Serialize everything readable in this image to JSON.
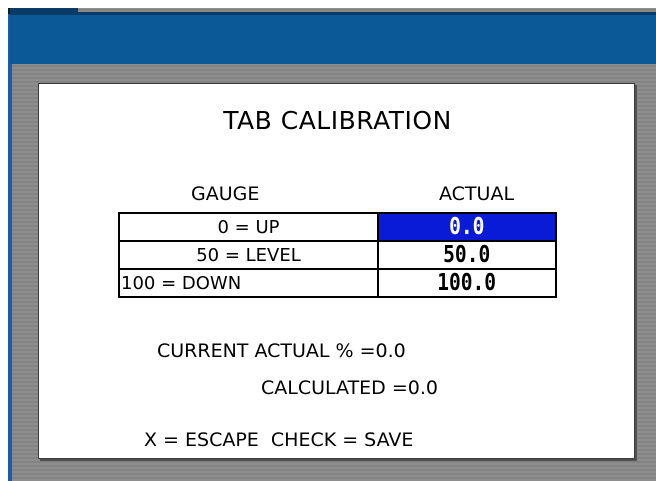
{
  "header": {
    "bar_color": "#0b5a97"
  },
  "panel": {
    "title": "TAB CALIBRATION",
    "columns": {
      "gauge": "GAUGE",
      "actual": "ACTUAL"
    },
    "rows": [
      {
        "gauge": "0 = UP",
        "actual": "0.0",
        "selected": true
      },
      {
        "gauge": "50 = LEVEL",
        "actual": "50.0",
        "selected": false
      },
      {
        "gauge": "100 = DOWN",
        "actual": "100.0",
        "selected": false
      }
    ],
    "current_actual_label": "CURRENT ACTUAL %",
    "current_actual_value": "=0.0",
    "calculated_label": "CALCULATED",
    "calculated_value": "=0.0",
    "hint": "X = ESCAPE  CHECK = SAVE",
    "selected_color": "#0a1bd8"
  }
}
